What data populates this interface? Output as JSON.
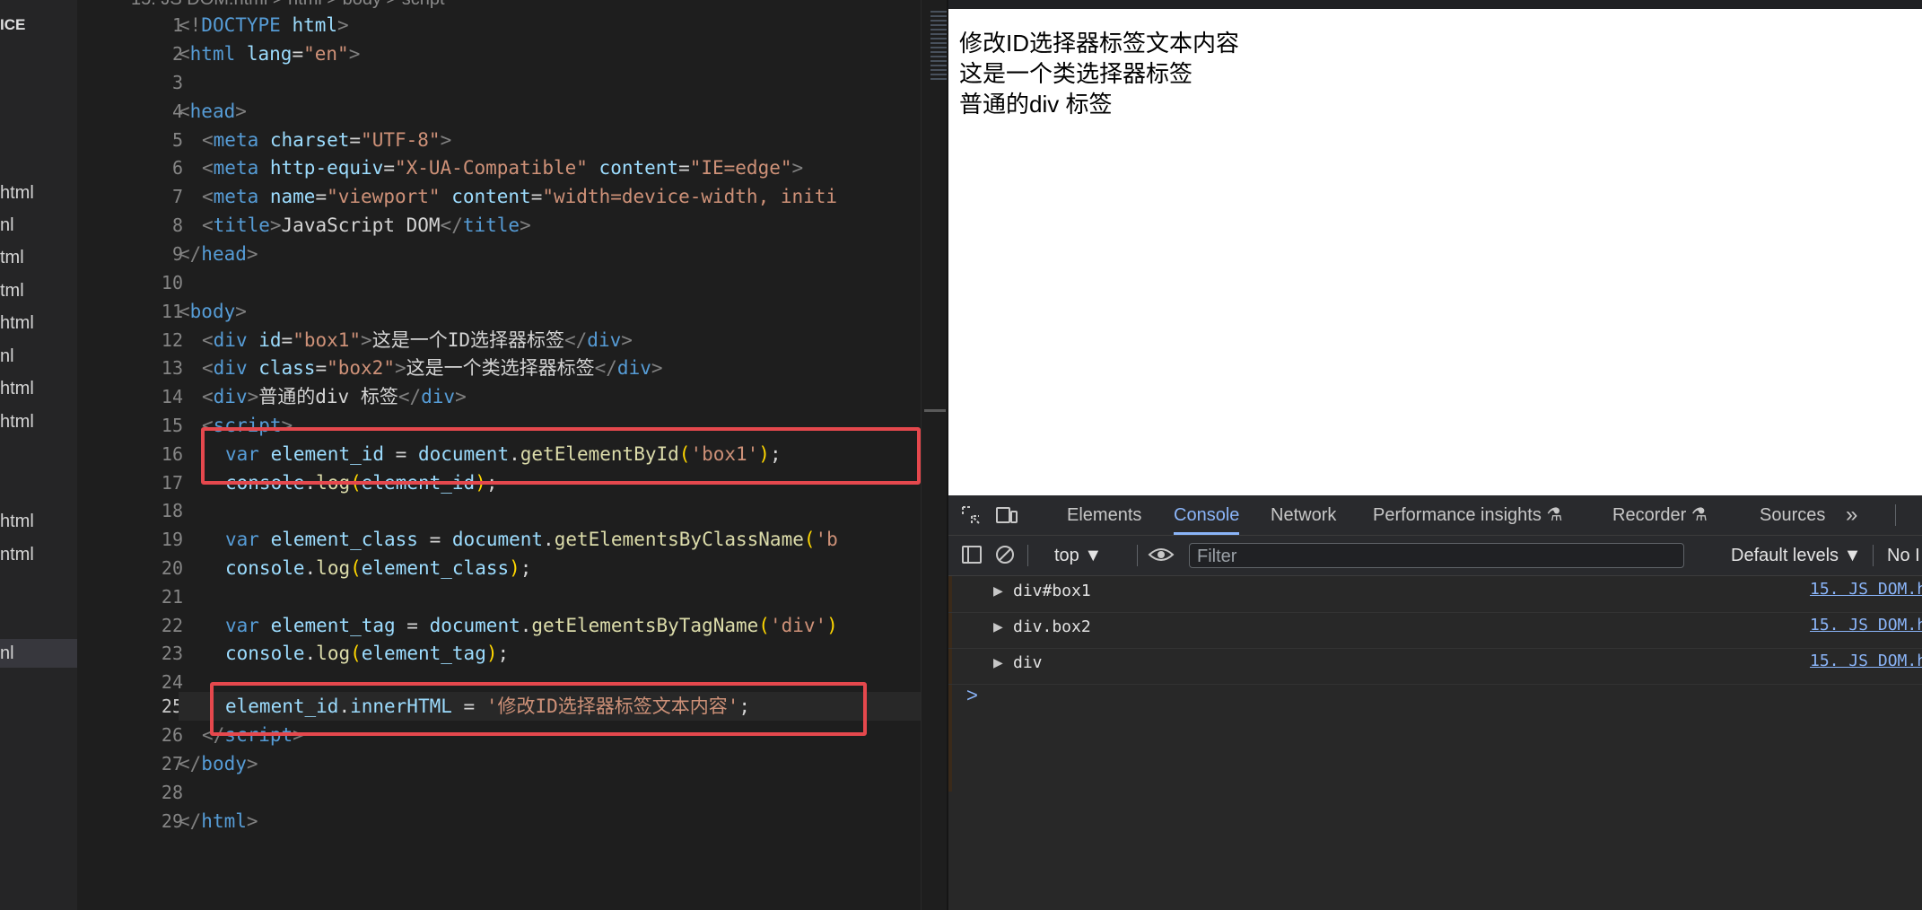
{
  "sidebar": {
    "title": "ICE",
    "files": [
      "html",
      "nl",
      "tml",
      "tml",
      "html",
      "nl",
      "html",
      "html",
      "html",
      "ntml",
      "nl"
    ]
  },
  "editor": {
    "breadcrumb": "15. JS DOM.html > html > body > script",
    "lines": [
      {
        "n": "1"
      },
      {
        "n": "2"
      },
      {
        "n": "3"
      },
      {
        "n": "4"
      },
      {
        "n": "5"
      },
      {
        "n": "6"
      },
      {
        "n": "7"
      },
      {
        "n": "8"
      },
      {
        "n": "9"
      },
      {
        "n": "10"
      },
      {
        "n": "11"
      },
      {
        "n": "12"
      },
      {
        "n": "13"
      },
      {
        "n": "14"
      },
      {
        "n": "15"
      },
      {
        "n": "16"
      },
      {
        "n": "17"
      },
      {
        "n": "18"
      },
      {
        "n": "19"
      },
      {
        "n": "20"
      },
      {
        "n": "21"
      },
      {
        "n": "22"
      },
      {
        "n": "23"
      },
      {
        "n": "24"
      },
      {
        "n": "25"
      },
      {
        "n": "26"
      },
      {
        "n": "27"
      },
      {
        "n": "28"
      },
      {
        "n": "29"
      }
    ],
    "code": {
      "l1": {
        "a": "<!",
        "b": "DOCTYPE",
        "c": " html",
        "d": ">"
      },
      "l2": {
        "a": "<",
        "b": "html",
        "c": " lang",
        "d": "=",
        "e": "\"en\"",
        "f": ">"
      },
      "l4": {
        "a": "<",
        "b": "head",
        "c": ">"
      },
      "l5": {
        "a": "<",
        "b": "meta",
        "c": " charset",
        "d": "=",
        "e": "\"UTF-8\"",
        "f": ">"
      },
      "l6": {
        "a": "<",
        "b": "meta",
        "c": " http-equiv",
        "d": "=",
        "e": "\"X-UA-Compatible\"",
        "f": " content",
        "g": "=",
        "h": "\"IE=edge\"",
        "i": ">"
      },
      "l7": {
        "a": "<",
        "b": "meta",
        "c": " name",
        "d": "=",
        "e": "\"viewport\"",
        "f": " content",
        "g": "=",
        "h": "\"width=device-width, initi"
      },
      "l8": {
        "a": "<",
        "b": "title",
        "c": ">",
        "d": "JavaScript DOM",
        "e": "</",
        "f": "title",
        "g": ">"
      },
      "l9": {
        "a": "</",
        "b": "head",
        "c": ">"
      },
      "l11": {
        "a": "<",
        "b": "body",
        "c": ">"
      },
      "l12": {
        "a": "<",
        "b": "div",
        "c": " id",
        "d": "=",
        "e": "\"box1\"",
        "f": ">",
        "g": "这是一个ID选择器标签",
        "h": "</",
        "i": "div",
        "j": ">"
      },
      "l13": {
        "a": "<",
        "b": "div",
        "c": " class",
        "d": "=",
        "e": "\"box2\"",
        "f": ">",
        "g": "这是一个类选择器标签",
        "h": "</",
        "i": "div",
        "j": ">"
      },
      "l14": {
        "a": "<",
        "b": "div",
        "c": ">",
        "d": "普通的div 标签",
        "e": "</",
        "f": "div",
        "g": ">"
      },
      "l15": {
        "a": "<",
        "b": "script",
        "c": ">"
      },
      "l16": {
        "a": "var",
        "b": " element_id",
        "c": " = ",
        "d": "document",
        "e": ".",
        "f": "getElementById",
        "g": "(",
        "h": "'box1'",
        "i": ")",
        "j": ";"
      },
      "l17": {
        "a": "console",
        "b": ".",
        "c": "log",
        "d": "(",
        "e": "element_id",
        "f": ")",
        "g": ";"
      },
      "l19": {
        "a": "var",
        "b": " element_class",
        "c": " = ",
        "d": "document",
        "e": ".",
        "f": "getElementsByClassName",
        "g": "(",
        "h": "'b"
      },
      "l20": {
        "a": "console",
        "b": ".",
        "c": "log",
        "d": "(",
        "e": "element_class",
        "f": ")",
        "g": ";"
      },
      "l22": {
        "a": "var",
        "b": " element_tag",
        "c": " = ",
        "d": "document",
        "e": ".",
        "f": "getElementsByTagName",
        "g": "(",
        "h": "'div'",
        "i": ")"
      },
      "l23": {
        "a": "console",
        "b": ".",
        "c": "log",
        "d": "(",
        "e": "element_tag",
        "f": ")",
        "g": ";"
      },
      "l25": {
        "a": "element_id",
        "b": ".",
        "c": "innerHTML",
        "d": " = ",
        "e": "'修改ID选择器标签文本内容'",
        "f": ";"
      },
      "l26": {
        "a": "</",
        "b": "script",
        "c": ">"
      },
      "l27": {
        "a": "</",
        "b": "body",
        "c": ">"
      },
      "l29": {
        "a": "</",
        "b": "html",
        "c": ">"
      }
    }
  },
  "browser": {
    "page_lines": [
      "修改ID选择器标签文本内容",
      "这是一个类选择器标签",
      "普通的div 标签"
    ],
    "devtools": {
      "tabs": [
        "Elements",
        "Console",
        "Network",
        "Performance insights",
        "Recorder",
        "Sources"
      ],
      "active_tab": "Console",
      "context": "top",
      "filter_placeholder": "Filter",
      "levels": "Default levels",
      "issues_partial": "No I",
      "logs": [
        {
          "msg": "div#box1",
          "src": "15. JS DOM.h"
        },
        {
          "msg": "div.box2",
          "src": "15. JS DOM.h"
        },
        {
          "msg": "div",
          "src": "15. JS DOM.h"
        }
      ],
      "prompt": ">"
    }
  },
  "colors": {
    "highlight": "#e5484d",
    "accent": "#8ab4f8"
  }
}
